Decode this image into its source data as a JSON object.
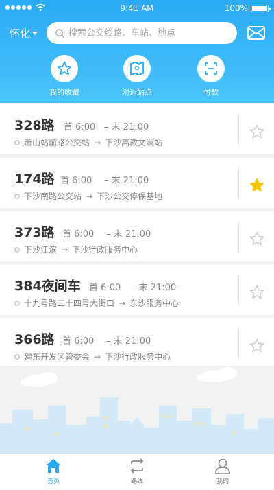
{
  "status_bar": {
    "time": "9:41 AM",
    "battery": "100%",
    "battery_level": 1.0
  },
  "header": {
    "city": "怀化",
    "search_placeholder": "搜索公交线路、车站、地点"
  },
  "quick_actions": [
    {
      "label": "我的收藏",
      "icon": "star-icon"
    },
    {
      "label": "附近站点",
      "icon": "map-icon"
    },
    {
      "label": "付款",
      "icon": "scan-icon"
    }
  ],
  "routes": [
    {
      "number": "328路",
      "first": "首 6:00",
      "last": "– 末 21:00",
      "from": "萧山站前路公交站",
      "arrow": "→",
      "to": "下沙高教文澜站",
      "favorite": false
    },
    {
      "number": "174路",
      "first": "首 6:00",
      "last": "– 末 21:00",
      "from": "下沙南路公交站",
      "arrow": "→",
      "to": "下沙公交停保基地",
      "favorite": true
    },
    {
      "number": "373路",
      "first": "首 6:00",
      "last": "– 末 21:00",
      "from": "下沙江滨",
      "arrow": "→",
      "to": "下沙行政服务中心",
      "favorite": false
    },
    {
      "number": "384夜间车",
      "first": "首 6:00",
      "last": "– 末 21:00",
      "from": "十九号路二十四号大街口",
      "arrow": "→",
      "to": "东沙服务中心",
      "favorite": false
    },
    {
      "number": "366路",
      "first": "首 6:00",
      "last": "– 末 21:00",
      "from": "建东开发区管委会",
      "arrow": "→",
      "to": "下沙行政服务中心",
      "favorite": false
    }
  ],
  "tabs": [
    {
      "label": "首页",
      "icon": "home-icon",
      "active": true
    },
    {
      "label": "路线",
      "icon": "route-icon",
      "active": false
    },
    {
      "label": "我的",
      "icon": "user-icon",
      "active": false
    }
  ],
  "colors": {
    "accent": "#2aa9f5",
    "star_active": "#f7c600",
    "star_inactive": "#c8c8c8"
  }
}
